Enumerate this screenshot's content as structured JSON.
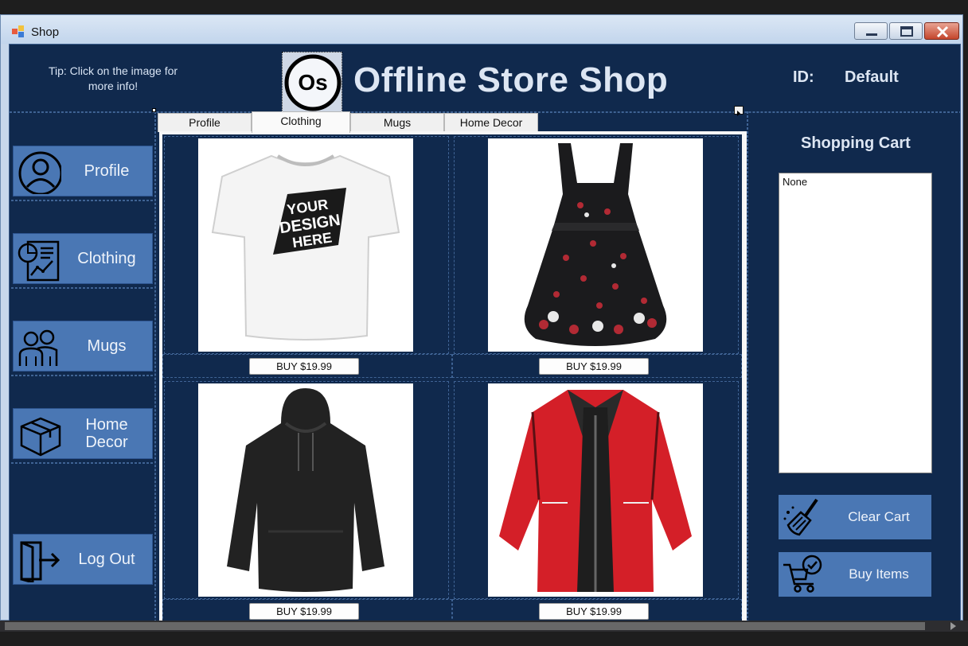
{
  "window": {
    "title": "Shop"
  },
  "header": {
    "tip": "Tip: Click on the image for more info!",
    "logo_text": "Os",
    "store_title": "Offline Store Shop",
    "id_label": "ID:",
    "id_value": "Default"
  },
  "nav": [
    {
      "label": "Profile",
      "icon": "user-circle-icon"
    },
    {
      "label": "Clothing",
      "icon": "report-chart-icon"
    },
    {
      "label": "Mugs",
      "icon": "people-icon"
    },
    {
      "label": "Home Decor",
      "icon": "box-icon"
    },
    {
      "label": "Log Out",
      "icon": "logout-door-icon"
    }
  ],
  "tabs": [
    {
      "label": "Profile"
    },
    {
      "label": "Clothing",
      "active": true
    },
    {
      "label": "Mugs"
    },
    {
      "label": "Home Decor"
    }
  ],
  "products": [
    {
      "image": "white t-shirt",
      "buy_label": "BUY  $19.99"
    },
    {
      "image": "floral skull dress",
      "buy_label": "BUY  $19.99"
    },
    {
      "image": "black hoodie",
      "buy_label": "BUY  $19.99"
    },
    {
      "image": "red jacket",
      "buy_label": "BUY  $19.99"
    }
  ],
  "tshirt_print": {
    "line1": "YOUR",
    "line2": "DESIGN",
    "line3": "HERE"
  },
  "cart": {
    "title": "Shopping Cart",
    "items_text": "None",
    "clear_label": "Clear Cart",
    "buy_label": "Buy Items"
  },
  "colors": {
    "background": "#10294d",
    "button": "#4a77b4",
    "text": "#dde6f3"
  }
}
